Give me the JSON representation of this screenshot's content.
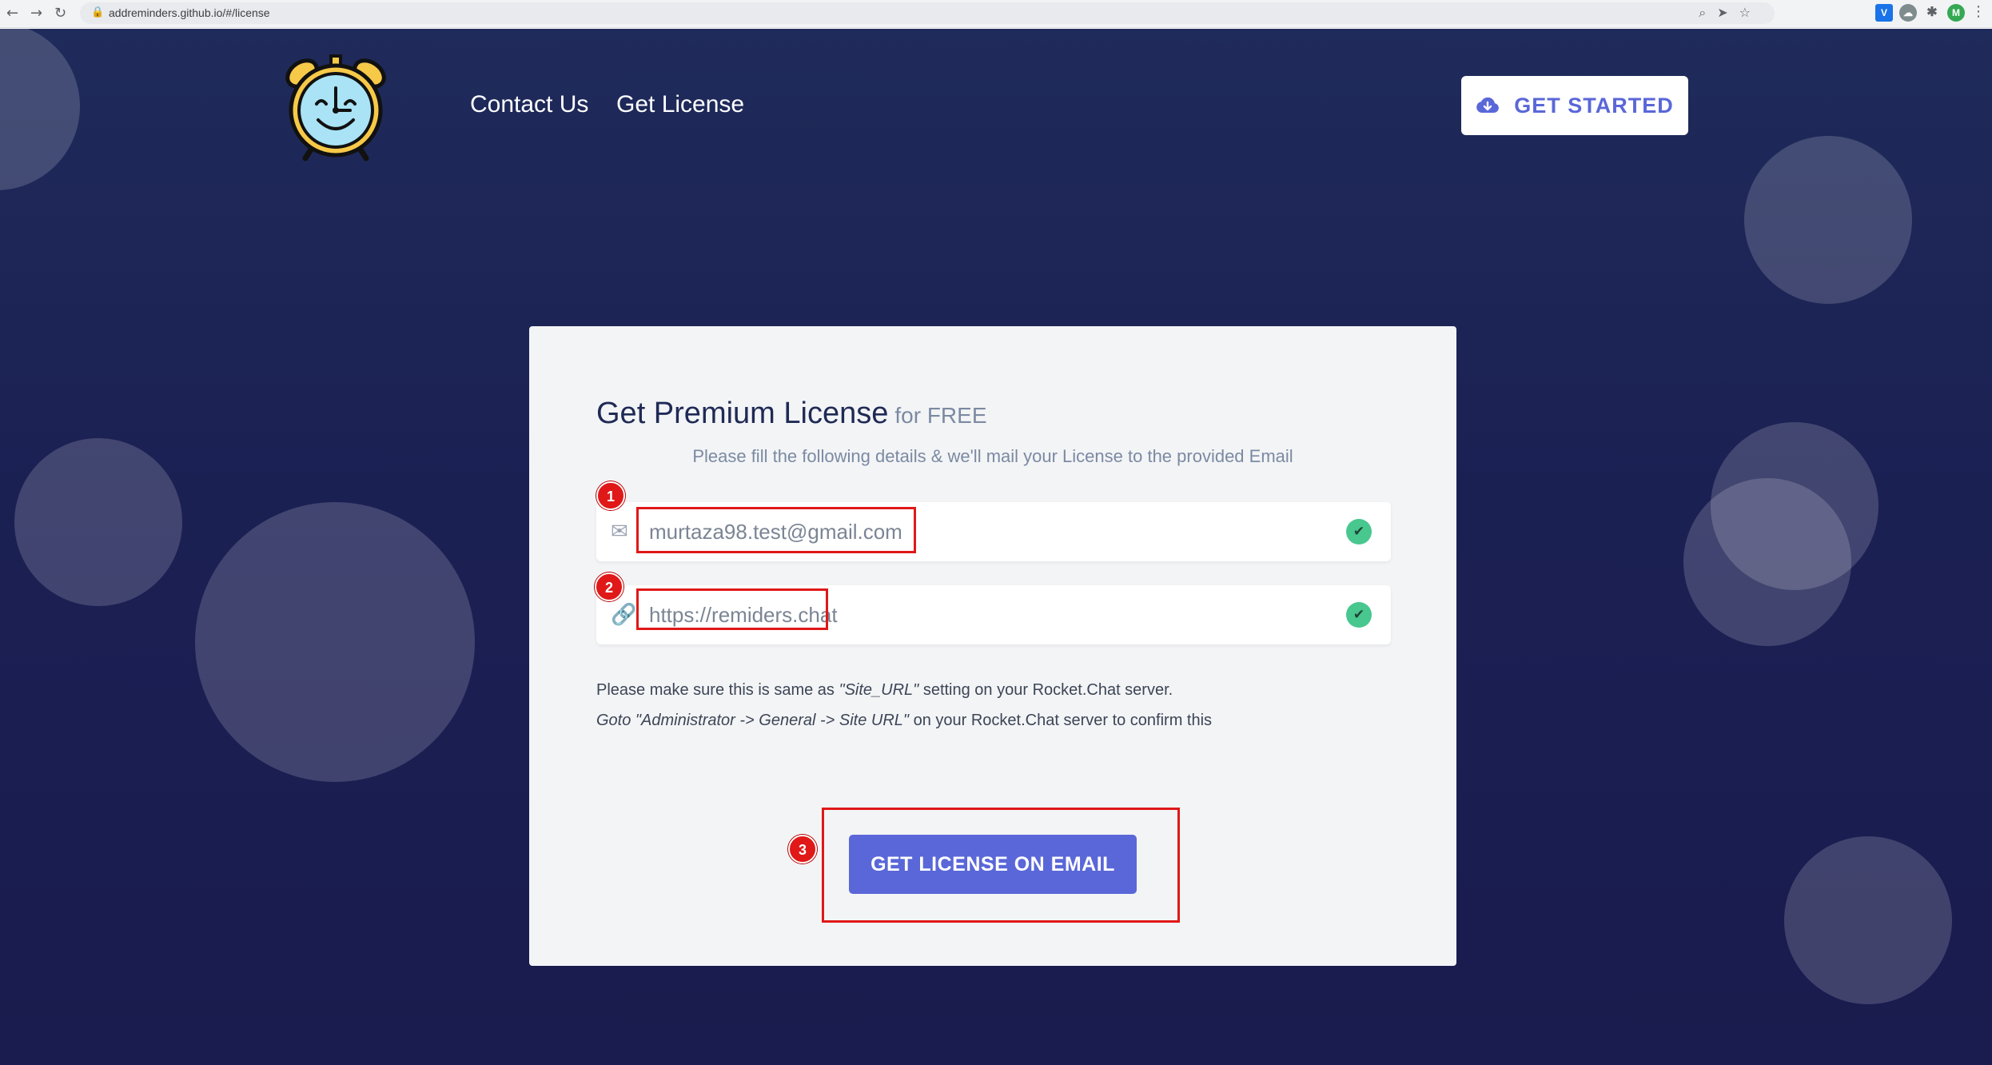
{
  "browser": {
    "url": "addreminders.github.io/#/license",
    "profile_initial": "M"
  },
  "header": {
    "nav": [
      {
        "label": "Contact Us"
      },
      {
        "label": "Get License"
      }
    ],
    "cta_label": "GET STARTED"
  },
  "license_form": {
    "title": "Get Premium License",
    "title_suffix": "for FREE",
    "subtitle": "Please fill the following details & we'll mail your License to the provided Email",
    "email_value": "murtaza98.test@gmail.com",
    "site_url_value": "https://remiders.chat",
    "help_line1_prefix": "Please make sure this is same as ",
    "help_line1_em": "\"Site_URL\"",
    "help_line1_suffix": " setting on your Rocket.Chat server.",
    "help_line2_em": "Goto \"Administrator -> General -> Site URL\"",
    "help_line2_suffix": " on your Rocket.Chat server to confirm this",
    "submit_label": "GET LICENSE ON EMAIL"
  },
  "annotations": {
    "step1": "1",
    "step2": "2",
    "step3": "3"
  },
  "colors": {
    "page_bg": "#1c2152",
    "accent": "#5a67d8",
    "valid": "#48c78e",
    "annotation": "#e01818"
  }
}
